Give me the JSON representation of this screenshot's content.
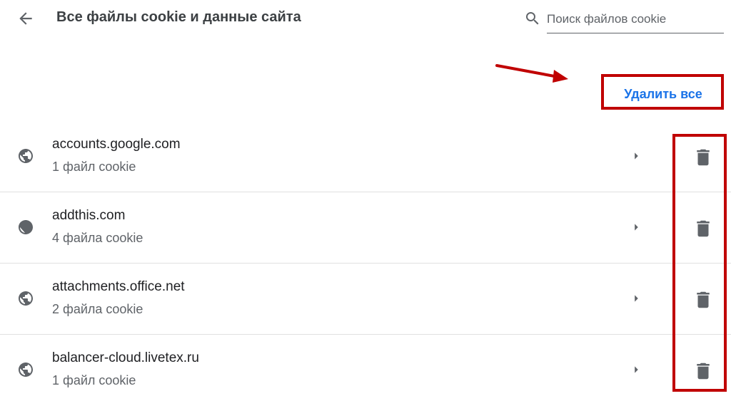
{
  "header": {
    "title": "Все файлы cookie и данные сайта",
    "back_icon": "arrow-back-icon"
  },
  "search": {
    "placeholder": "Поиск файлов cookie",
    "value": "",
    "icon": "search-icon"
  },
  "actions": {
    "delete_all_label": "Удалить все"
  },
  "sites": [
    {
      "name": "accounts.google.com",
      "count": "1 файл cookie"
    },
    {
      "name": "addthis.com",
      "count": "4 файла cookie"
    },
    {
      "name": "attachments.office.net",
      "count": "2 файла cookie"
    },
    {
      "name": "balancer-cloud.livetex.ru",
      "count": "1 файл cookie"
    }
  ],
  "colors": {
    "accent": "#1a73e8",
    "annotation": "#c00000",
    "icon": "#5f6368",
    "text_primary": "#202124",
    "text_secondary": "#5f6368",
    "divider": "#e0e0e0"
  }
}
